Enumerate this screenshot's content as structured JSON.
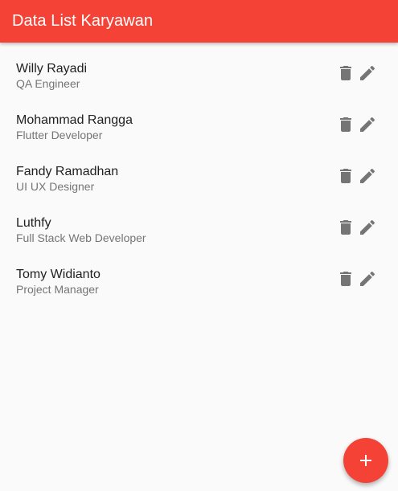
{
  "app_bar": {
    "title": "Data List Karyawan",
    "color": "#f44336"
  },
  "employees": [
    {
      "name": "Willy Rayadi",
      "role": "QA Engineer"
    },
    {
      "name": "Mohammad Rangga",
      "role": "Flutter Developer"
    },
    {
      "name": "Fandy Ramadhan",
      "role": "UI UX Designer"
    },
    {
      "name": "Luthfy",
      "role": "Full Stack Web Developer"
    },
    {
      "name": "Tomy Widianto",
      "role": "Project Manager"
    }
  ],
  "row_actions": {
    "delete_icon": "delete-icon",
    "edit_icon": "edit-icon"
  },
  "fab": {
    "icon": "add-icon",
    "color": "#f44336"
  }
}
